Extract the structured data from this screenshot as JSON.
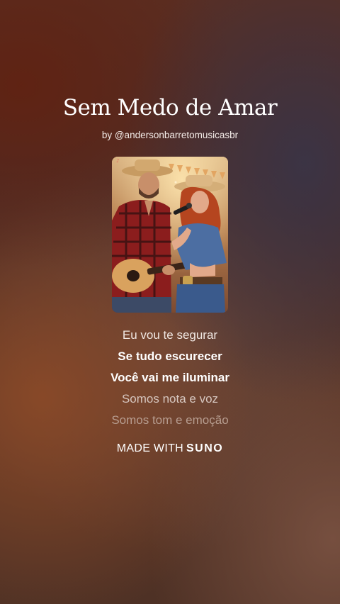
{
  "song": {
    "title": "Sem Medo de Amar",
    "byline": "by @andersonbarretomusicasbr"
  },
  "cover": {
    "icon": "album-cover-image"
  },
  "lyrics": [
    "Eu vou te segurar",
    "Se tudo escurecer",
    "Você vai me iluminar",
    "Somos nota e voz",
    "Somos tom e emoção"
  ],
  "footer": {
    "made_with": "MADE WITH",
    "brand": "SUNO"
  }
}
